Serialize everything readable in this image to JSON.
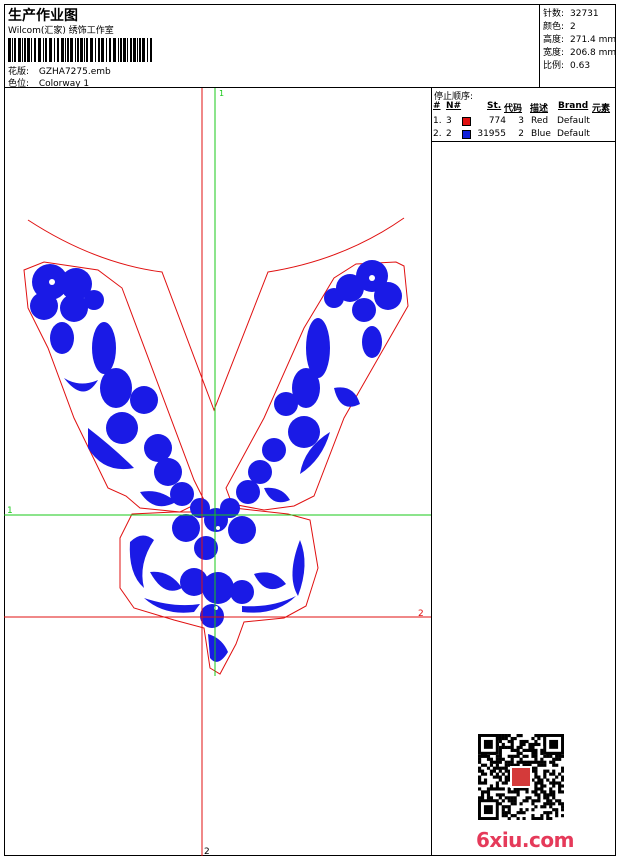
{
  "header": {
    "title": "生产作业图",
    "subtitle": "Wilcom(汇家) 绣饰工作室",
    "design_label": "花版:",
    "design_value": "GZHA7275.emb",
    "colorway_label": "色位:",
    "colorway_value": "Colorway 1"
  },
  "specs": [
    {
      "label": "针数:",
      "value": "32731"
    },
    {
      "label": "颜色:",
      "value": "2"
    },
    {
      "label": "高度:",
      "value": "271.4 mm"
    },
    {
      "label": "宽度:",
      "value": "206.8 mm"
    },
    {
      "label": "比例:",
      "value": "0.63"
    }
  ],
  "stop_sequence": {
    "title": "停止顺序:",
    "columns": [
      "#",
      "N#",
      "St.",
      "代码",
      "描述",
      "Brand",
      "元素"
    ],
    "rows": [
      {
        "index": "1.",
        "num": "3",
        "color": "#e01010",
        "stitches": "774",
        "code": "3",
        "desc": "Red",
        "brand": "Default"
      },
      {
        "index": "2.",
        "num": "2",
        "color": "#1020d8",
        "stitches": "31955",
        "code": "2",
        "desc": "Blue",
        "brand": "Default"
      }
    ]
  },
  "guides": {
    "v_top_label": "1",
    "v_bottom_label": "2",
    "h_left_label": "1",
    "h_right_label": "2"
  },
  "colors": {
    "outline": "#e01010",
    "fill": "#1a1ae6",
    "guide": "#18c818"
  },
  "watermark": "6xiu.com"
}
